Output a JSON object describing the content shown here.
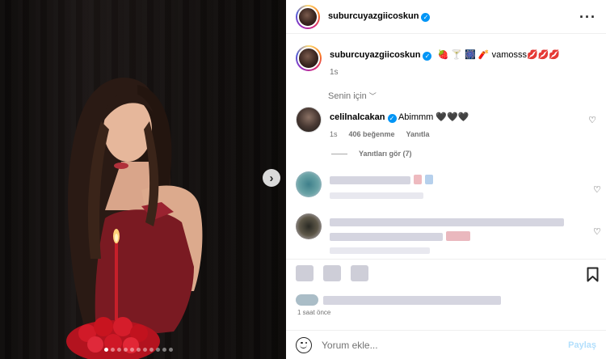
{
  "post": {
    "author": "suburcuyazgiicoskun",
    "caption_emojis": "🍓 🍸 🎆 🧨",
    "caption_text": "vamosss",
    "caption_kisses": "💋💋💋",
    "time": "1s"
  },
  "sort": {
    "label": "Senin için"
  },
  "comments": [
    {
      "username": "celilnalcakan",
      "text": "Abimmm 🖤🖤🖤",
      "time": "1s",
      "likes": "406 beğenme",
      "reply_label": "Yanıtla"
    }
  ],
  "replies": {
    "label": "Yanıtları gör (7)"
  },
  "footer": {
    "time_ago": "1 saat önce"
  },
  "composer": {
    "placeholder": "Yorum ekle...",
    "post_label": "Paylaş"
  },
  "carousel": {
    "slides": 11,
    "active": 0
  },
  "colors": {
    "verified": "#0095f6",
    "muted": "#737373",
    "post_disabled": "#b2dffc"
  },
  "icons": [
    "more-options-icon",
    "verified-icon",
    "heart-icon",
    "bookmark-icon",
    "emoji-icon",
    "chevron-right-icon",
    "chevron-down-icon"
  ]
}
